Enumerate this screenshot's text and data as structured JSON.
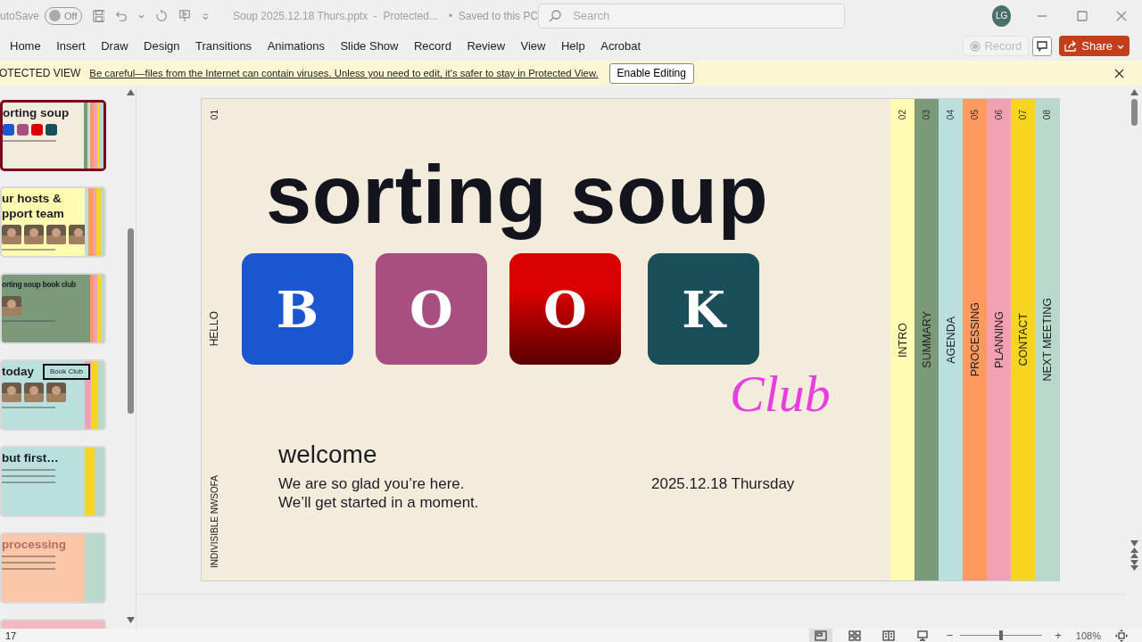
{
  "title_bar": {
    "autosave_label": "utoSave",
    "autosave": {
      "label": "Off",
      "on": false
    },
    "document_title": "Soup 2025.12.18 Thurs.pptx  -  Protected...",
    "saved": "•  Saved to this PC",
    "search": {
      "placeholder": "Search"
    },
    "avatar": "LG"
  },
  "ribbon": {
    "tabs": [
      {
        "label": "Home",
        "selected": false
      },
      {
        "label": "Insert",
        "selected": false
      },
      {
        "label": "Draw",
        "selected": false
      },
      {
        "label": "Design",
        "selected": false
      },
      {
        "label": "Transitions",
        "selected": false
      },
      {
        "label": "Animations",
        "selected": false
      },
      {
        "label": "Slide Show",
        "selected": false
      },
      {
        "label": "Record",
        "selected": false
      },
      {
        "label": "Review",
        "selected": false
      },
      {
        "label": "View",
        "selected": false
      },
      {
        "label": "Help",
        "selected": false
      },
      {
        "label": "Acrobat",
        "selected": false
      }
    ],
    "record": {
      "label": "Record",
      "disabled": true
    },
    "share": "Share"
  },
  "protected_view": {
    "label": "OTECTED VIEW",
    "message": "Be careful—files from the Internet can contain viruses. Unless you need to edit, it's safer to stay in Protected View.",
    "button": "Enable Editing"
  },
  "thumbnails": [
    {
      "kind": "cover",
      "lines": [
        "orting soup"
      ],
      "color": "#f3ebdc",
      "selected": true
    },
    {
      "kind": "team",
      "lines": [
        "ur hosts &",
        "pport team"
      ],
      "color": "#fffbb0",
      "selected": false
    },
    {
      "kind": "summary",
      "lines": [
        "orting soup book club"
      ],
      "color": "#7a9a7a",
      "selected": false
    },
    {
      "kind": "agenda",
      "lines": [
        "today"
      ],
      "badge": "Book Club",
      "color": "#b9e0dc",
      "selected": false
    },
    {
      "kind": "text",
      "lines": [
        "but first…"
      ],
      "color": "#b9e0dc",
      "selected": false
    },
    {
      "kind": "processing",
      "lines": [
        "processing"
      ],
      "color": "#fcc7a8",
      "selected": false
    },
    {
      "kind": "blank",
      "color": "#f6b8c0",
      "selected": false
    }
  ],
  "slide": {
    "number": "01",
    "side_label": "HELLO",
    "footer": "INDIVISIBLE NWSOFA",
    "title": "sorting soup",
    "tiles": [
      {
        "letter": "B",
        "color": "#1a56d0",
        "kind": "flat"
      },
      {
        "letter": "O",
        "color": "#a84f82",
        "kind": "flat"
      },
      {
        "letter": "O",
        "color": "#d80000",
        "kind": "gradient"
      },
      {
        "letter": "K",
        "color": "#1a4f5a",
        "kind": "flat"
      }
    ],
    "script_word": "Club",
    "heading": "welcome",
    "lines": [
      "We are so glad you’re here.",
      "We’ll get started in a moment."
    ],
    "date": "2025.12.18  Thursday",
    "stripes": [
      {
        "number": "02",
        "label": "INTRO",
        "color": "#fffbb0"
      },
      {
        "number": "03",
        "label": "SUMMARY",
        "color": "#7a9a7a"
      },
      {
        "number": "04",
        "label": "AGENDA",
        "color": "#b9e0dc"
      },
      {
        "number": "05",
        "label": "PROCESSING",
        "color": "#fe9a60"
      },
      {
        "number": "06",
        "label": "PLANNING",
        "color": "#f2a0b4"
      },
      {
        "number": "07",
        "label": "CONTACT",
        "color": "#f6d520"
      },
      {
        "number": "08",
        "label": "NEXT MEETING",
        "color": "#b8d8cc"
      }
    ]
  },
  "status_bar": {
    "slide_count": "17",
    "views": [
      {
        "kind": "normal",
        "selected": true
      },
      {
        "kind": "sorter",
        "selected": false
      },
      {
        "kind": "reading",
        "selected": false
      },
      {
        "kind": "show",
        "selected": false
      }
    ],
    "zoom": {
      "minus": "−",
      "plus": "+",
      "level": 0.5,
      "reading": "108%"
    }
  }
}
